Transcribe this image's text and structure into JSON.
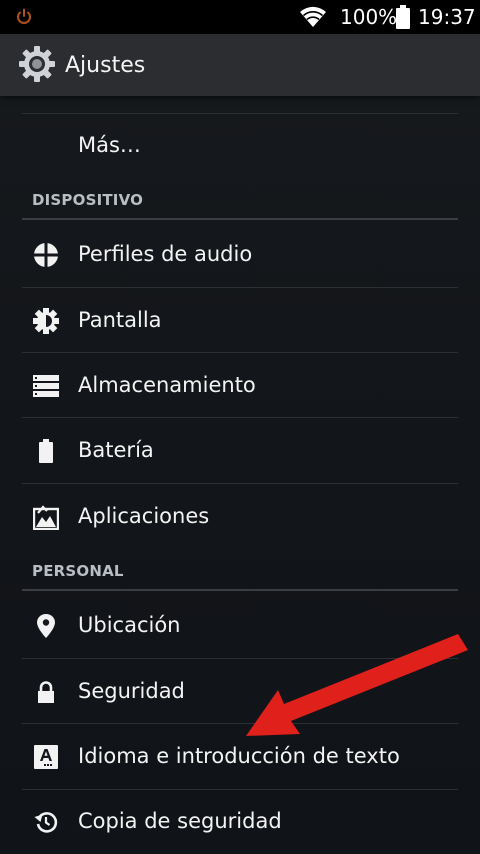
{
  "statusbar": {
    "battery_text": "100%",
    "time": "19:37"
  },
  "actionbar": {
    "title": "Ajustes"
  },
  "items_top": [
    {
      "label": "Más…"
    }
  ],
  "sections": [
    {
      "header": "DISPOSITIVO",
      "items": [
        {
          "label": "Perfiles de audio",
          "icon": "audio-profiles-icon"
        },
        {
          "label": "Pantalla",
          "icon": "display-brightness-icon"
        },
        {
          "label": "Almacenamiento",
          "icon": "storage-icon"
        },
        {
          "label": "Batería",
          "icon": "battery-icon"
        },
        {
          "label": "Aplicaciones",
          "icon": "apps-icon"
        }
      ]
    },
    {
      "header": "PERSONAL",
      "items": [
        {
          "label": "Ubicación",
          "icon": "location-pin-icon"
        },
        {
          "label": "Seguridad",
          "icon": "lock-icon"
        },
        {
          "label": "Idioma e introducción de texto",
          "icon": "language-keyboard-icon"
        },
        {
          "label": "Copia de seguridad",
          "icon": "backup-restore-icon"
        }
      ]
    }
  ],
  "colors": {
    "arrow": "#e0201b",
    "actionbar": "#2b2d30",
    "statusbar": "#000000",
    "power_icon": "#b0501e"
  }
}
